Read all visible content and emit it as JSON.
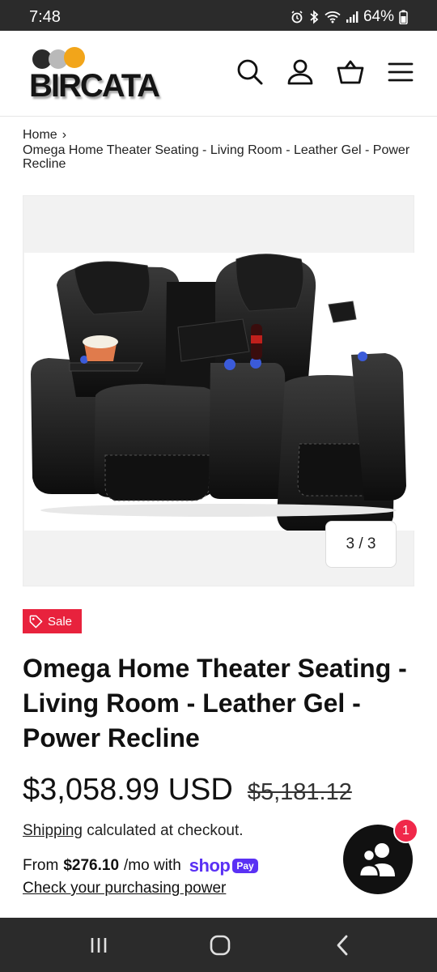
{
  "status_bar": {
    "time": "7:48",
    "battery": "64%",
    "icons": [
      "alarm-icon",
      "bluetooth-icon",
      "wifi-icon",
      "signal-icon",
      "battery-icon"
    ]
  },
  "header": {
    "logo_text": "BIRCATA",
    "icons": [
      "search-icon",
      "account-icon",
      "cart-icon",
      "menu-icon"
    ]
  },
  "breadcrumb": {
    "home": "Home",
    "current": "Omega Home Theater Seating - Living Room - Leather Gel - Power Recline"
  },
  "gallery": {
    "counter": "3 / 3"
  },
  "product": {
    "badge": "Sale",
    "title": "Omega Home Theater Seating - Living Room - Leather Gel - Power Recline",
    "price": "$3,058.99 USD",
    "compare_price": "$5,181.12",
    "shipping_link": "Shipping",
    "shipping_text": " calculated at checkout.",
    "installment_prefix": "From ",
    "installment_amount": "$276.10",
    "installment_suffix": "/mo with",
    "shop_word": "shop",
    "pay_word": "Pay",
    "check_power": "Check your purchasing power"
  },
  "chat": {
    "badge_count": "1"
  },
  "colors": {
    "sale_red": "#e8223d",
    "shop_pay_purple": "#5a31f4",
    "status_bar": "#2b2b2b"
  },
  "nav_bar": {
    "buttons": [
      "recents-icon",
      "home-icon",
      "back-icon"
    ]
  }
}
